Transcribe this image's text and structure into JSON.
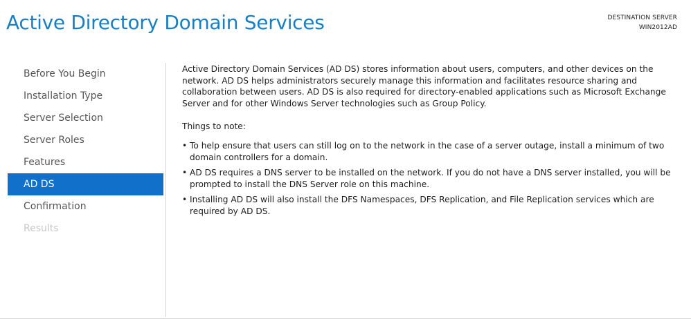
{
  "header": {
    "title": "Active Directory Domain Services",
    "destination_label": "DESTINATION SERVER",
    "destination_server": "WIN2012AD"
  },
  "nav": {
    "items": [
      {
        "label": "Before You Begin",
        "state": "normal"
      },
      {
        "label": "Installation Type",
        "state": "normal"
      },
      {
        "label": "Server Selection",
        "state": "normal"
      },
      {
        "label": "Server Roles",
        "state": "normal"
      },
      {
        "label": "Features",
        "state": "normal"
      },
      {
        "label": "AD DS",
        "state": "active"
      },
      {
        "label": "Confirmation",
        "state": "normal"
      },
      {
        "label": "Results",
        "state": "disabled"
      }
    ]
  },
  "content": {
    "intro": "Active Directory Domain Services (AD DS) stores information about users, computers, and other devices on the network.  AD DS helps administrators securely manage this information and facilitates resource sharing and collaboration between users.  AD DS is also required for directory-enabled applications such as Microsoft Exchange Server and for other Windows Server technologies such as Group Policy.",
    "note_heading": "Things to note:",
    "bullet_glyph": "•",
    "bullets": [
      "To help ensure that users can still log on to the network in the case of a server outage, install a minimum of two domain controllers for a domain.",
      "AD DS requires a DNS server to be installed on the network.  If you do not have a DNS server installed, you will be prompted to install the DNS Server role on this machine.",
      "Installing AD DS will also install the DFS Namespaces, DFS Replication, and File Replication services which are required by AD DS."
    ]
  },
  "colors": {
    "title": "#1a7fc1",
    "active_nav_bg": "#1170c9",
    "active_nav_text": "#ffffff",
    "nav_text": "#555555",
    "disabled_nav_text": "#c8c8c8",
    "divider": "#d4d4d4"
  }
}
